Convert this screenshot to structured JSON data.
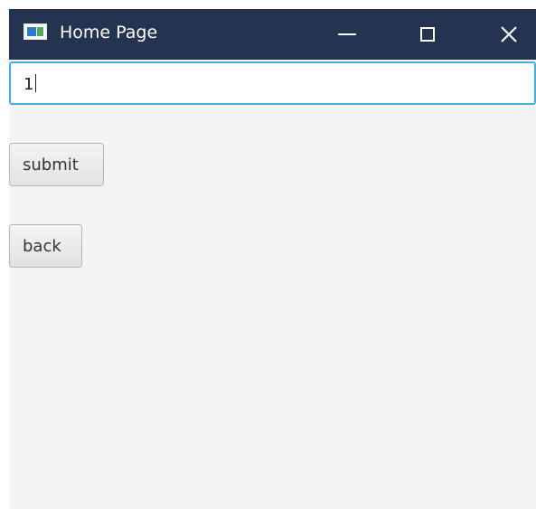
{
  "window": {
    "title": "Home Page",
    "controls": {
      "minimize_icon": "minimize-icon",
      "maximize_icon": "maximize-icon",
      "close_icon": "close-icon",
      "close_glyph": "✕"
    },
    "colors": {
      "titlebar": "#243450",
      "content_bg": "#f4f4f4",
      "focus_border": "#3fb0e2"
    }
  },
  "form": {
    "input_value": "1",
    "submit_label": "submit",
    "back_label": "back"
  }
}
